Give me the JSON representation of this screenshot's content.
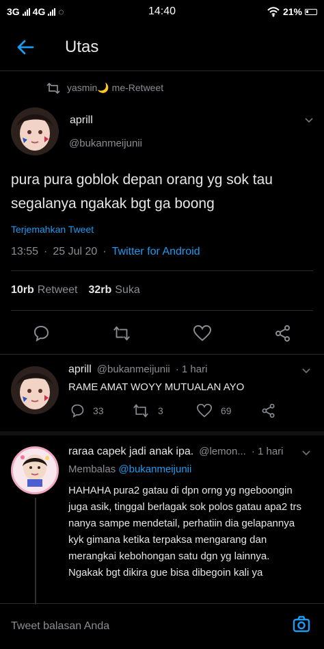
{
  "status_bar": {
    "left_items": [
      "3G",
      "4G"
    ],
    "time": "14:40",
    "battery": "21%"
  },
  "header": {
    "title": "Utas",
    "back_icon": "arrow-left-icon"
  },
  "retweet": {
    "text": "yasmin🌙 me-Retweet"
  },
  "tweet": {
    "name": "aprill",
    "handle": "@bukanmeijunii",
    "text": "pura pura goblok depan orang yg sok tau segalanya ngakak bgt ga boong",
    "translate": "Terjemahkan Tweet",
    "time": "13:55",
    "date": "25 Jul 20",
    "source": "Twitter for Android",
    "retweets": "10rb",
    "retweets_label": "Retweet",
    "likes": "32rb",
    "likes_label": "Suka"
  },
  "replies": [
    {
      "name": "aprill",
      "handle": "@bukanmeijunii",
      "time": "· 1 hari",
      "text": "RAME AMAT WOYY MUTUALAN AYO",
      "reply_count": "33",
      "retweet_count": "3",
      "like_count": "69"
    },
    {
      "name": "raraa capek jadi anak ipa.",
      "handle": "@lemon...",
      "time": "· 1 hari",
      "replying_to_prefix": "Membalas",
      "replying_to": "@bukanmeijunii",
      "text": "HAHAHA pura2 gatau di dpn orng yg ngeboongin juga asik, tinggal berlagak sok polos gatau apa2 trs nanya sampe mendetail, perhatiin dia gelapannya kyk gimana ketika terpaksa mengarang dan merangkai kebohongan satu dgn yg lainnya. Ngakak bgt dikira gue bisa dibegoin kali ya"
    }
  ],
  "composer": {
    "placeholder": "Tweet balasan Anda"
  },
  "colors": {
    "accent": "#1d9bf0",
    "background": "#000000",
    "muted": "#8a8d91"
  }
}
